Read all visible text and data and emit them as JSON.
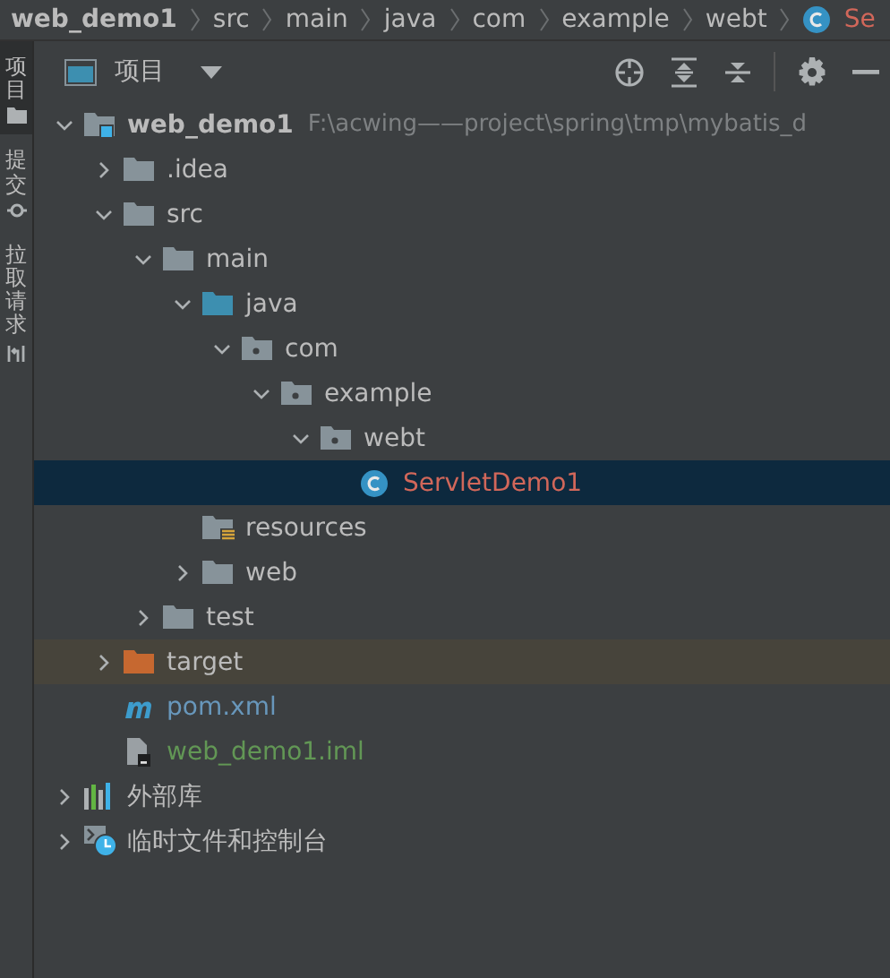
{
  "breadcrumbs": [
    {
      "label": "web_demo1",
      "kind": "module"
    },
    {
      "label": "src",
      "kind": "folder"
    },
    {
      "label": "main",
      "kind": "folder"
    },
    {
      "label": "java",
      "kind": "folder"
    },
    {
      "label": "com",
      "kind": "folder"
    },
    {
      "label": "example",
      "kind": "folder"
    },
    {
      "label": "webt",
      "kind": "folder"
    },
    {
      "label": "Se",
      "kind": "class"
    }
  ],
  "side_stripe": [
    {
      "label": "项目",
      "kind": "project",
      "selected": true
    },
    {
      "label": "提交",
      "kind": "commit",
      "selected": false
    },
    {
      "label": "拉取请求",
      "kind": "pull",
      "selected": false
    }
  ],
  "panel": {
    "title": "项目"
  },
  "tree": [
    {
      "label": "web_demo1",
      "kind": "module",
      "hint": "F:\\acwing——project\\spring\\tmp\\mybatis_d",
      "expanded": true,
      "selected": false,
      "children": [
        {
          "label": ".idea",
          "kind": "folder",
          "expanded": false,
          "selected": false
        },
        {
          "label": "src",
          "kind": "folder",
          "expanded": true,
          "selected": false,
          "children": [
            {
              "label": "main",
              "kind": "folder",
              "expanded": true,
              "selected": false,
              "children": [
                {
                  "label": "java",
                  "kind": "source",
                  "expanded": true,
                  "selected": false,
                  "children": [
                    {
                      "label": "com",
                      "kind": "package",
                      "expanded": true,
                      "selected": false,
                      "children": [
                        {
                          "label": "example",
                          "kind": "package",
                          "expanded": true,
                          "selected": false,
                          "children": [
                            {
                              "label": "webt",
                              "kind": "package",
                              "expanded": true,
                              "selected": false,
                              "children": [
                                {
                                  "label": "ServletDemo1",
                                  "kind": "class",
                                  "color": "#d1675a",
                                  "selected": true
                                }
                              ]
                            }
                          ]
                        }
                      ]
                    }
                  ]
                },
                {
                  "label": "resources",
                  "kind": "resources",
                  "selected": false
                },
                {
                  "label": "web",
                  "kind": "folder",
                  "expanded": false,
                  "selected": false
                }
              ]
            },
            {
              "label": "test",
              "kind": "folder",
              "expanded": false,
              "selected": false
            }
          ]
        },
        {
          "label": "target",
          "kind": "excluded",
          "expanded": false,
          "selected": false
        },
        {
          "label": "pom.xml",
          "kind": "maven",
          "color": "#6897bb",
          "selected": false
        },
        {
          "label": "web_demo1.iml",
          "kind": "iml",
          "color": "#629755",
          "selected": false
        }
      ]
    },
    {
      "label": "外部库",
      "kind": "libraries",
      "expanded": false,
      "selected": false
    },
    {
      "label": "临时文件和控制台",
      "kind": "scratches",
      "expanded": false,
      "selected": false
    }
  ]
}
